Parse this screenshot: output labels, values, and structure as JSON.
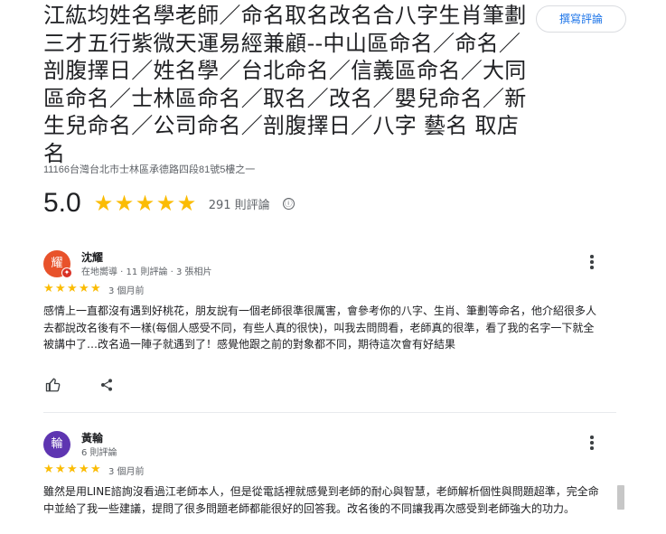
{
  "place": {
    "title": "江紘均姓名學老師／命名取名改名合八字生肖筆劃三才五行紫微天運易經兼顧--中山區命名／命名／剖腹擇日／姓名學／台北命名／信義區命名／大同區命名／士林區命名／取名／改名／嬰兒命名／新生兒命名／公司命名／剖腹擇日／八字 藝名 取店名",
    "address": "11166台灣台北市士林區承德路四段81號5樓之一",
    "rating": "5.0",
    "review_count": "291 則評論",
    "write_review_label": "撰寫評論",
    "info_icon": "ⓘ"
  },
  "reviews": [
    {
      "avatar_letter": "耀",
      "avatar_color": "#e8522b",
      "name": "沈耀",
      "meta": "在地嚮導 · 11 則評論 · 3 張相片",
      "stars": "★★★★★",
      "date": "3 個月前",
      "text": "感情上一直都沒有遇到好桃花，朋友說有一個老師很準很厲害，會參考你的八字、生肖、筆劃等命名，他介紹很多人去都說改名後有不一樣(每個人感受不同，有些人真的很快)，叫我去問問看，老師真的很準，看了我的名字一下就全被講中了…改名過一陣子就遇到了！感覺他跟之前的對象都不同，期待這次會有好結果"
    },
    {
      "avatar_letter": "輪",
      "avatar_color": "#5e35b1",
      "name": "黃輪",
      "meta": "6 則評論",
      "stars": "★★★★★",
      "date": "3 個月前",
      "text": "雖然是用LINE諮詢沒看過江老師本人，但是從電話裡就感覺到老師的耐心與智慧，老師解析個性與問題超準，完全命中並給了我一些建議，提問了很多問題老師都能很好的回答我。改名後的不同讓我再次感受到老師強大的功力。"
    }
  ],
  "icons": {
    "star": "star-icon",
    "like": "thumbs-up-icon",
    "share": "share-icon",
    "more": "more-vertical-icon"
  },
  "colors": {
    "star": "#fbbc04",
    "accent": "#1a73e8"
  }
}
